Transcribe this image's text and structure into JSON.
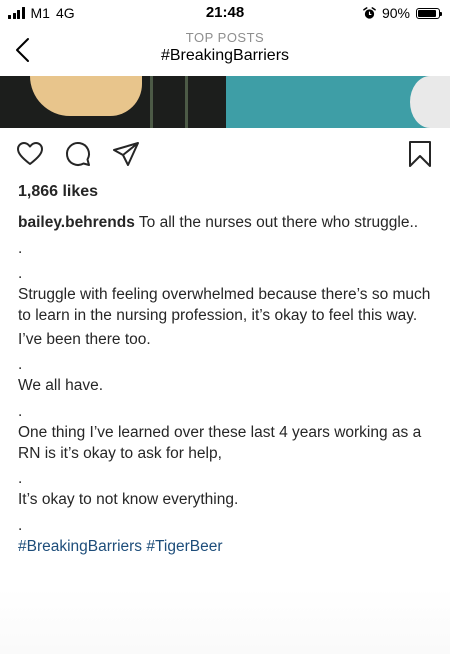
{
  "status_bar": {
    "carrier": "M1",
    "network": "4G",
    "time": "21:48",
    "battery": "90%",
    "battery_level": 0.9,
    "icons": [
      "signal-icon",
      "alarm-icon",
      "battery-icon"
    ]
  },
  "header": {
    "subtitle": "TOP POSTS",
    "title": "#BreakingBarriers",
    "back_icon": "chevron-left-icon"
  },
  "actions": {
    "icons": [
      "heart-icon",
      "comment-icon",
      "share-icon",
      "bookmark-icon"
    ]
  },
  "post": {
    "likes": "1,866 likes",
    "username": "bailey.behrends",
    "caption_first": " To all the nurses out there who struggle..",
    "lines": [
      ".",
      ".",
      "Struggle with feeling overwhelmed because there’s so much to learn in the nursing profession, it’s okay to feel this way.",
      "I’ve been there too.",
      ".",
      "We all have.",
      ".",
      "One thing I’ve learned over these last 4 years working as a RN is it’s okay to ask for help,",
      ".",
      "It’s okay to not know everything.",
      "."
    ],
    "hashtags": [
      "#BreakingBarriers",
      "#TigerBeer"
    ]
  },
  "colors": {
    "text": "#262626",
    "hashtag": "#1d4d7a",
    "subtitle": "#8e8e8e"
  }
}
